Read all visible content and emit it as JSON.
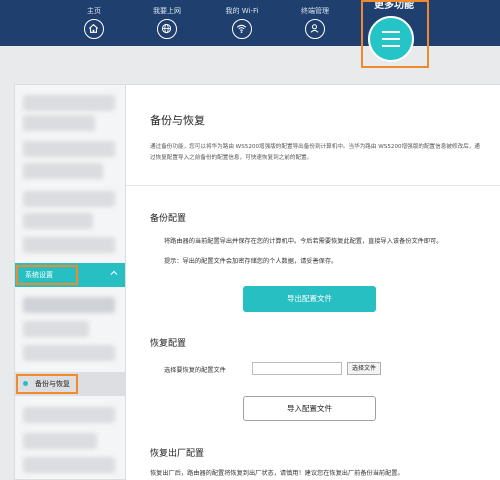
{
  "topnav": {
    "items": [
      {
        "label": "主页",
        "icon": "home-icon"
      },
      {
        "label": "我要上网",
        "icon": "globe-icon"
      },
      {
        "label": "我的 Wi-Fi",
        "icon": "wifi-icon"
      },
      {
        "label": "终端管理",
        "icon": "user-icon"
      }
    ],
    "more": {
      "label": "更多功能",
      "icon": "menu-icon"
    },
    "colors": {
      "bar": "#1f3f6e",
      "accent": "#25c4c6",
      "highlight": "#ef8a2e"
    }
  },
  "sidebar": {
    "group_label": "系统设置",
    "active_item": "备份与恢复"
  },
  "main": {
    "title": "备份与恢复",
    "description": "通过备份功能，您可以将华为路由 WS5200增强版的配置导出备份到计算机中。当华为路由 WS5200增强版的配置信息被修改后，通过恢复配置导入之前备份的配置信息，可快速恢复到之前的配置。",
    "backup": {
      "heading": "备份配置",
      "text1": "将路由器的当前配置导出并保存在您的计算机中。今后若需要恢复此配置，直接导入该备份文件即可。",
      "text2": "提示：导出的配置文件会加密存储您的个人数据，请妥善保存。",
      "export_button": "导出配置文件"
    },
    "restore": {
      "heading": "恢复配置",
      "select_label": "选择要恢复的配置文件",
      "file_value": "",
      "browse_button": "选择文件",
      "import_button": "导入配置文件"
    },
    "factory": {
      "heading": "恢复出厂配置",
      "text": "恢复出厂后，路由器的配置将恢复到出厂状态，请慎用！建议您在恢复出厂前备份当前配置。"
    }
  }
}
